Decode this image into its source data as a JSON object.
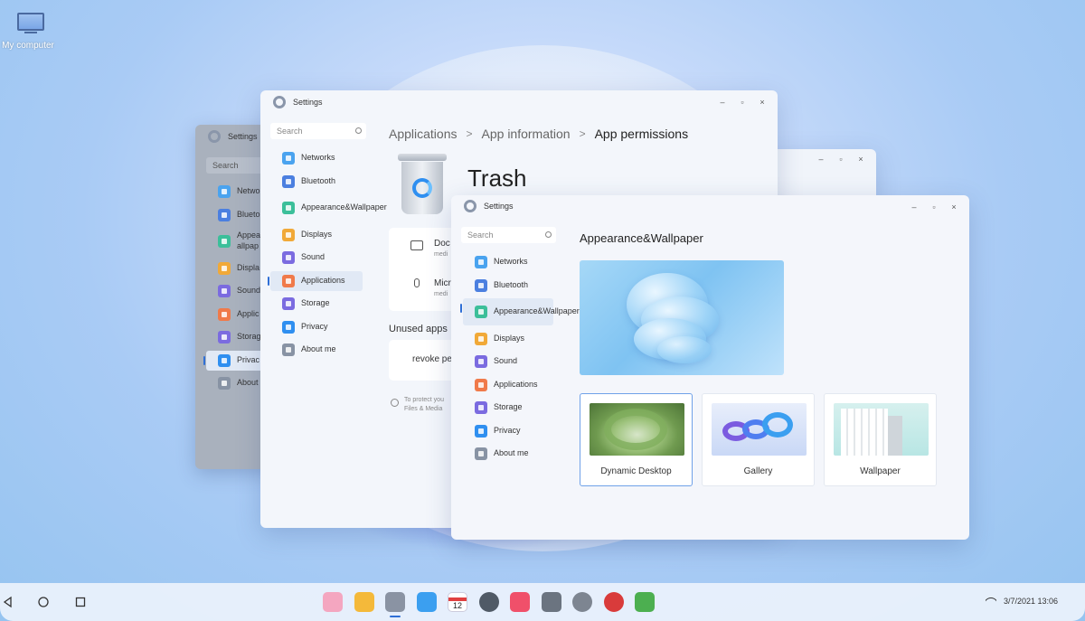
{
  "desktop": {
    "icon_label": "My computer"
  },
  "window_back": {
    "title": "Settings",
    "search_placeholder": "Search",
    "items": [
      {
        "label": "Netwo",
        "color": "#4aa3ef"
      },
      {
        "label": "Blueto",
        "color": "#4b7fe0"
      },
      {
        "label": "Appea\nallpap",
        "color": "#3cbf9a"
      },
      {
        "label": "Displa",
        "color": "#f1a938"
      },
      {
        "label": "Sound",
        "color": "#7b6be0"
      },
      {
        "label": "Applic",
        "color": "#f07a4a"
      },
      {
        "label": "Storag",
        "color": "#7b6be0"
      },
      {
        "label": "Privac",
        "color": "#2f8ff0"
      },
      {
        "label": "About",
        "color": "#8893a4"
      }
    ]
  },
  "window_mid": {
    "title": "Settings",
    "search_placeholder": "Search",
    "items": [
      {
        "label": "Networks",
        "color": "#4aa3ef"
      },
      {
        "label": "Bluetooth",
        "color": "#4b7fe0"
      },
      {
        "label": "Appearance&Wallpaper",
        "color": "#3cbf9a"
      },
      {
        "label": "Displays",
        "color": "#f1a938"
      },
      {
        "label": "Sound",
        "color": "#7b6be0"
      },
      {
        "label": "Applications",
        "color": "#f07a4a"
      },
      {
        "label": "Storage",
        "color": "#7b6be0"
      },
      {
        "label": "Privacy",
        "color": "#2f8ff0"
      },
      {
        "label": "About me",
        "color": "#8893a4"
      }
    ],
    "breadcrumb": [
      "Applications",
      "App information",
      "App permissions"
    ],
    "app_name": "Trash",
    "permissions": [
      {
        "label": "Doc",
        "sub": "medi"
      },
      {
        "label": "Micr",
        "sub": "medi"
      }
    ],
    "unused_title": "Unused apps",
    "revoke_label": "revoke pe",
    "note_line1": "To protect you",
    "note_line2": "Files & Media"
  },
  "window_front": {
    "title": "Settings",
    "search_placeholder": "Search",
    "items": [
      {
        "label": "Networks",
        "color": "#4aa3ef"
      },
      {
        "label": "Bluetooth",
        "color": "#4b7fe0"
      },
      {
        "label": "Appearance&Wallpaper",
        "color": "#3cbf9a"
      },
      {
        "label": "Displays",
        "color": "#f1a938"
      },
      {
        "label": "Sound",
        "color": "#7b6be0"
      },
      {
        "label": "Applications",
        "color": "#f07a4a"
      },
      {
        "label": "Storage",
        "color": "#7b6be0"
      },
      {
        "label": "Privacy",
        "color": "#2f8ff0"
      },
      {
        "label": "About me",
        "color": "#8893a4"
      }
    ],
    "page_title": "Appearance&Wallpaper",
    "options": [
      {
        "label": "Dynamic Desktop"
      },
      {
        "label": "Gallery"
      },
      {
        "label": "Wallpaper"
      }
    ]
  },
  "window_controls": {
    "minimize": "–",
    "maximize": "▫",
    "close": "×"
  },
  "taskbar": {
    "apps": [
      {
        "name": "app-store-icon",
        "color": "#f4a6c0"
      },
      {
        "name": "file-manager-icon",
        "color": "#f4b93a"
      },
      {
        "name": "settings-icon",
        "color": "#8a93a3"
      },
      {
        "name": "mail-icon",
        "color": "#3b9ff0"
      },
      {
        "name": "calendar-icon",
        "color": "#ffffff"
      },
      {
        "name": "browser-icon",
        "color": "#505a66"
      },
      {
        "name": "video-player-icon",
        "color": "#f0506a"
      },
      {
        "name": "calculator-icon",
        "color": "#6b7480"
      },
      {
        "name": "clock-icon",
        "color": "#7d8591"
      },
      {
        "name": "recorder-icon",
        "color": "#d93b3b"
      },
      {
        "name": "photos-icon",
        "color": "#4caf50"
      }
    ],
    "calendar_day": "12",
    "datetime": "3/7/2021 13:06"
  }
}
